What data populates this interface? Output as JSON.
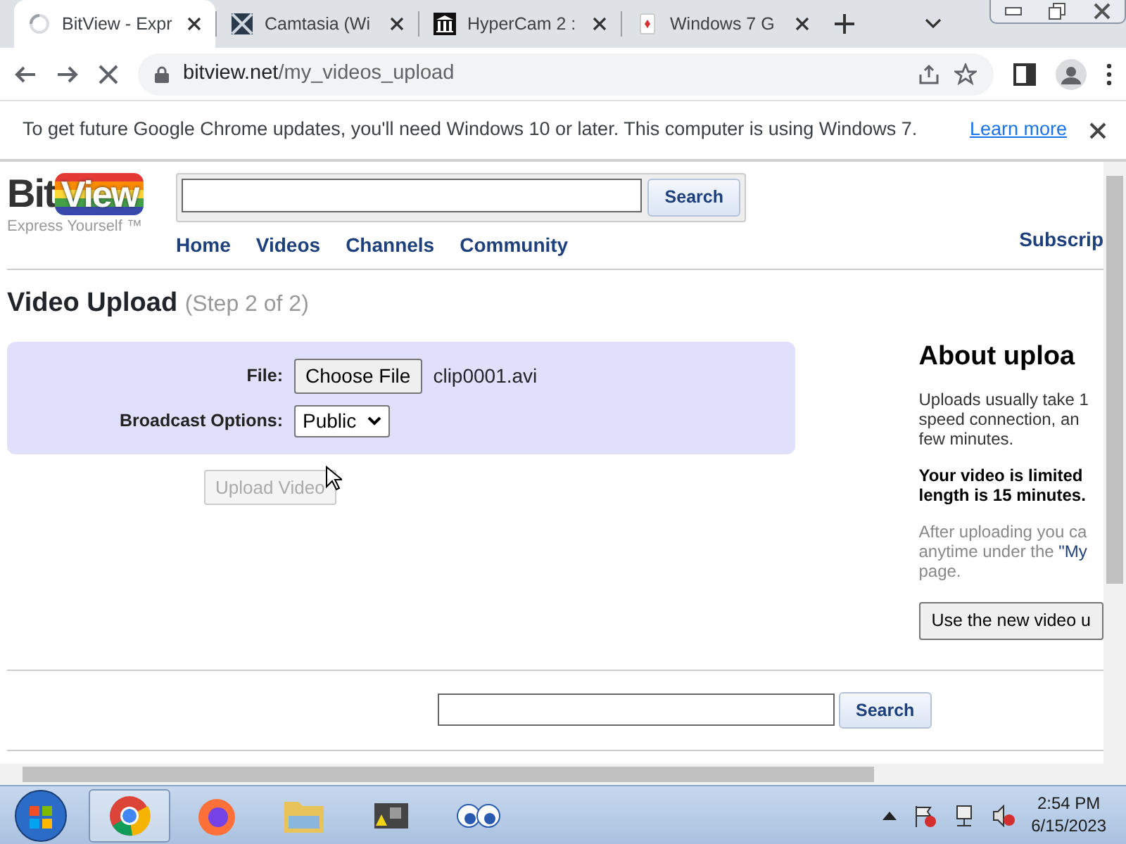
{
  "browser": {
    "tabs": [
      {
        "title": "BitView - Expr",
        "selected": true
      },
      {
        "title": "Camtasia (Wi",
        "selected": false
      },
      {
        "title": "HyperCam 2 :",
        "selected": false
      },
      {
        "title": "Windows 7 G",
        "selected": false
      }
    ],
    "address": {
      "host": "bitview.net",
      "path": "/my_videos_upload"
    }
  },
  "infobar": {
    "message": "To get future Google Chrome updates, you'll need Windows 10 or later. This computer is using Windows 7.",
    "link": "Learn more"
  },
  "site": {
    "logo": {
      "left": "Bit",
      "right": "View",
      "tagline": "Express Yourself ™"
    },
    "search_button": "Search",
    "nav": [
      "Home",
      "Videos",
      "Channels",
      "Community"
    ],
    "subscribe": "Subscrip",
    "heading": "Video Upload",
    "step": "(Step 2 of 2)",
    "form": {
      "file_label": "File:",
      "file_button": "Choose File",
      "file_name": "clip0001.avi",
      "broadcast_label": "Broadcast Options:",
      "broadcast_value": "Public",
      "upload_button": {
        "label": "Upload Video",
        "disabled": true
      }
    },
    "sidebar": {
      "title": "About uploa",
      "intro": [
        "Uploads usually take 1",
        "speed connection, an",
        "few minutes."
      ],
      "limit": [
        "Your video is limited",
        "length is 15 minutes."
      ],
      "after": [
        "After uploading you ca",
        "anytime under the "
      ],
      "after_link": "\"My",
      "after_end": "page.",
      "button": "Use the new video u"
    },
    "footer_search_button": "Search"
  },
  "taskbar": {
    "apps": [
      {
        "active": true
      },
      {
        "active": false
      },
      {
        "active": false
      },
      {
        "active": false
      },
      {
        "active": false
      }
    ],
    "time": "2:54 PM",
    "date": "6/15/2023"
  }
}
